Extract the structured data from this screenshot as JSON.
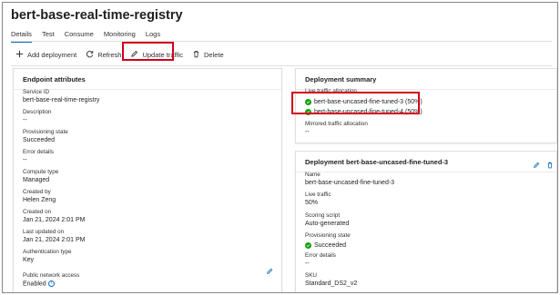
{
  "header": {
    "title": "bert-base-real-time-registry"
  },
  "tabs": [
    {
      "label": "Details"
    },
    {
      "label": "Test"
    },
    {
      "label": "Consume"
    },
    {
      "label": "Monitoring"
    },
    {
      "label": "Logs"
    }
  ],
  "toolbar": {
    "add_label": "Add deployment",
    "refresh_label": "Refresh",
    "update_label": "Update traffic",
    "delete_label": "Delete"
  },
  "colors": {
    "accent": "#0f6cbd",
    "highlight": "#d0021b",
    "success": "#13a10e"
  },
  "endpoint": {
    "title": "Endpoint attributes",
    "service_id_label": "Service ID",
    "service_id": "bert-base-real-time-registry",
    "description_label": "Description",
    "description": "--",
    "provisioning_label": "Provisioning state",
    "provisioning": "Succeeded",
    "error_label": "Error details",
    "error": "--",
    "compute_label": "Compute type",
    "compute": "Managed",
    "created_by_label": "Created by",
    "created_by": "Helen Zeng",
    "created_on_label": "Created on",
    "created_on": "Jan 21, 2024 2:01 PM",
    "updated_label": "Last updated on",
    "updated": "Jan 21, 2024 2:01 PM",
    "auth_label": "Authentication type",
    "auth": "Key",
    "network_label": "Public network access",
    "network": "Enabled"
  },
  "summary": {
    "title": "Deployment summary",
    "live_label": "Live traffic allocation",
    "live": [
      "bert-base-uncased-fine-tuned-3 (50%)",
      "bert-base-uncased-fine-tuned-4 (50%)"
    ],
    "mirrored_label": "Mirrored traffic allocation",
    "mirrored": "--"
  },
  "deployment": {
    "title": "Deployment bert-base-uncased-fine-tuned-3",
    "name_label": "Name",
    "name": "bert-base-uncased-fine-tuned-3",
    "live_label": "Live traffic",
    "live": "50%",
    "scoring_label": "Scoring script",
    "scoring": "Auto-generated",
    "prov_label": "Provisioning state",
    "prov": "Succeeded",
    "error_label": "Error details",
    "error": "--",
    "sku_label": "SKU",
    "sku": "Standard_DS2_v2"
  }
}
